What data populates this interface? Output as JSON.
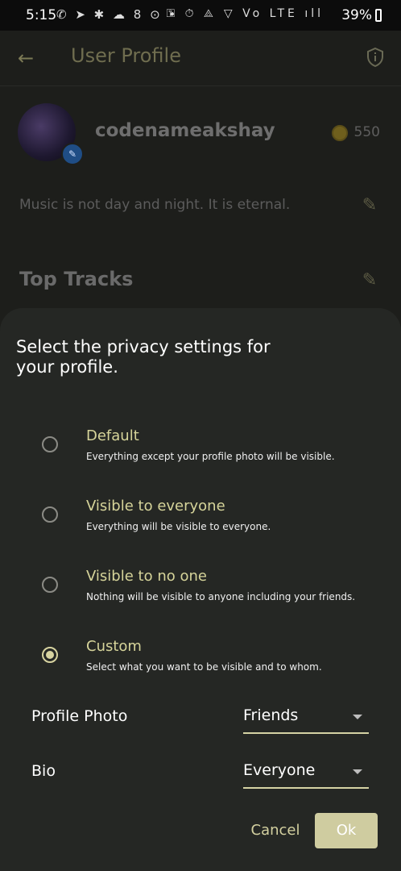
{
  "status_bar": {
    "time": "5:15",
    "notification_icons": "✆ ➤ ✱ ☁ 8 ⊙ •",
    "system_icons": "⚿ ⏱ ⟁ ▽ Vo LTE ıll",
    "battery": "39%"
  },
  "app_bar": {
    "title": "User Profile",
    "back_icon": "←",
    "action_icon": "shield-info-icon"
  },
  "profile": {
    "username": "codenameakshay",
    "coins": "550",
    "bio": "Music is not day and night. It is eternal.",
    "edit_icon": "✎"
  },
  "sections": {
    "top_tracks": "Top Tracks"
  },
  "privacy_sheet": {
    "title": "Select the privacy settings for your profile.",
    "options": [
      {
        "title": "Default",
        "description": "Everything except your profile photo will be visible.",
        "selected": false
      },
      {
        "title": "Visible to everyone",
        "description": "Everything will be visible to everyone.",
        "selected": false
      },
      {
        "title": "Visible to no one",
        "description": "Nothing will be visible to anyone including your friends.",
        "selected": false
      },
      {
        "title": "Custom",
        "description": "Select what you want to be visible and to whom.",
        "selected": true
      }
    ],
    "custom_fields": [
      {
        "label": "Profile Photo",
        "value": "Friends"
      },
      {
        "label": "Bio",
        "value": "Everyone"
      }
    ],
    "cancel_label": "Cancel",
    "ok_label": "Ok"
  },
  "colors": {
    "accent": "#d7d3a0",
    "sheet_background": "#252724",
    "page_background": "#1d1e1b"
  }
}
